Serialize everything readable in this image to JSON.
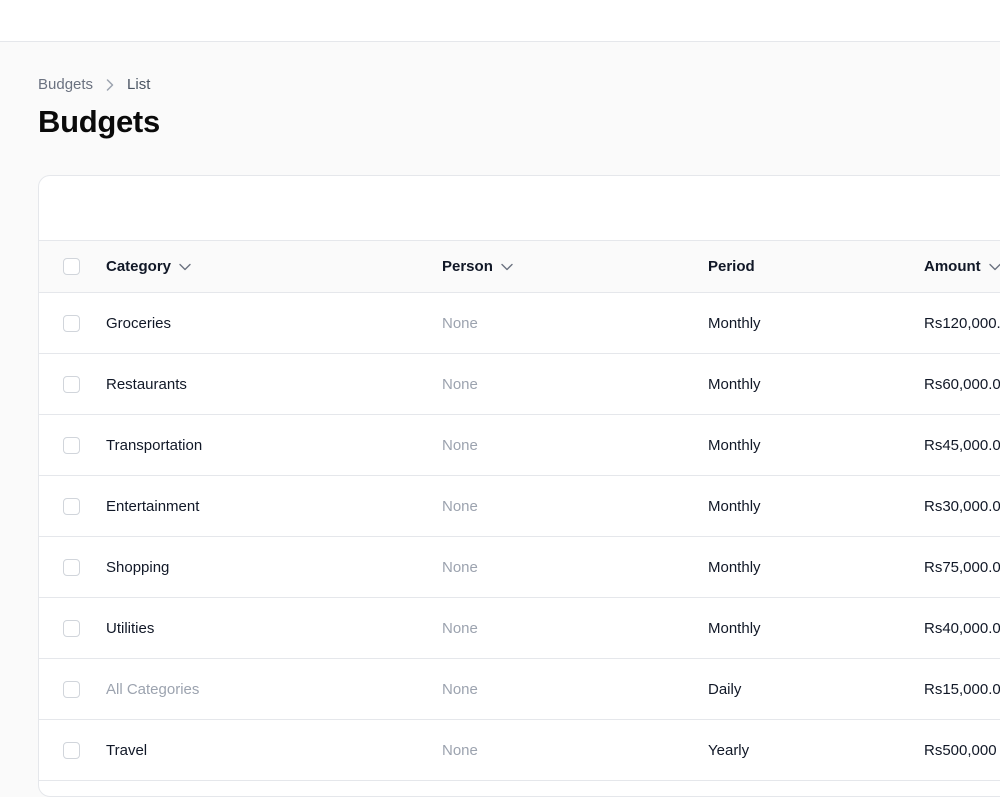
{
  "breadcrumb": {
    "root": "Budgets",
    "current": "List"
  },
  "page": {
    "title": "Budgets"
  },
  "table": {
    "columns": {
      "category": "Category",
      "person": "Person",
      "period": "Period",
      "amount": "Amount"
    },
    "rows": [
      {
        "category": "Groceries",
        "person": "None",
        "period": "Monthly",
        "amount": "Rs120,000."
      },
      {
        "category": "Restaurants",
        "person": "None",
        "period": "Monthly",
        "amount": "Rs60,000.0"
      },
      {
        "category": "Transportation",
        "person": "None",
        "period": "Monthly",
        "amount": "Rs45,000.0"
      },
      {
        "category": "Entertainment",
        "person": "None",
        "period": "Monthly",
        "amount": "Rs30,000.0"
      },
      {
        "category": "Shopping",
        "person": "None",
        "period": "Monthly",
        "amount": "Rs75,000.0"
      },
      {
        "category": "Utilities",
        "person": "None",
        "period": "Monthly",
        "amount": "Rs40,000.0"
      },
      {
        "category": "All Categories",
        "person": "None",
        "period": "Daily",
        "amount": "Rs15,000.0"
      },
      {
        "category": "Travel",
        "person": "None",
        "period": "Yearly",
        "amount": "Rs500,000"
      }
    ]
  },
  "icons": {
    "breadcrumb_separator": "chevron-right-icon",
    "sort": "chevron-down-icon"
  },
  "colors": {
    "muted_text": "#9ca3af",
    "primary_text": "#111827",
    "border": "#e5e7eb"
  }
}
